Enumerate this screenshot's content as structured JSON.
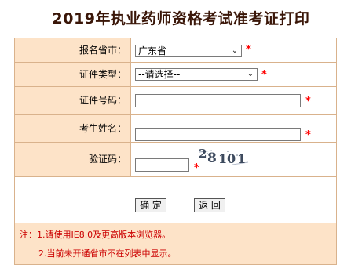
{
  "page": {
    "title": "2019年执业药师资格考试准考证打印"
  },
  "form": {
    "fields": [
      {
        "label": "报名省市：",
        "type": "select",
        "value": "广东省",
        "required": true
      },
      {
        "label": "证件类型：",
        "type": "select",
        "value": "--请选择--",
        "required": true
      },
      {
        "label": "证件号码：",
        "type": "text",
        "value": "",
        "required": true
      },
      {
        "label": "考生姓名：",
        "type": "text",
        "value": "",
        "required": true
      },
      {
        "label": "验证码：",
        "type": "captcha",
        "value": "",
        "required": true
      }
    ],
    "required_mark": "*",
    "captcha_text": "28101",
    "captcha_chars": [
      "2",
      "8",
      "1",
      "0",
      "1"
    ]
  },
  "buttons": {
    "confirm": "确 定",
    "back": "返 回"
  },
  "notes": {
    "line1": "注：1.请使用IE8.0及更高版本浏览器。",
    "line2": "2.当前未开通省市不在列表中显示。"
  },
  "colors": {
    "title": "#3a1608",
    "label_bg": "#fde3c8",
    "border": "#d9b28c",
    "required": "#ff0000",
    "note_text": "#cc0000"
  },
  "icons": {
    "dropdown_arrow": "chevron-down-icon"
  }
}
